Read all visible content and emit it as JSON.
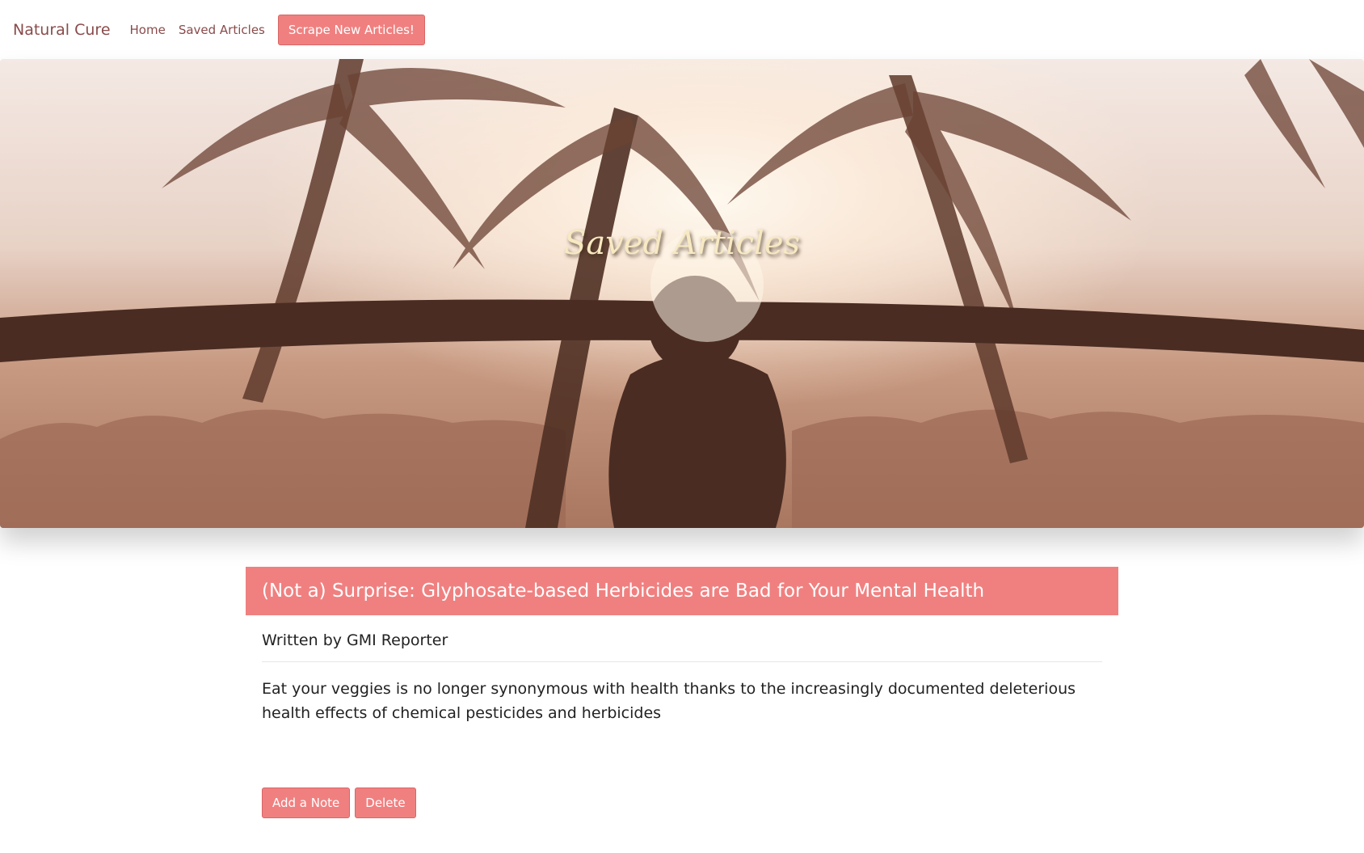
{
  "navbar": {
    "brand": "Natural Cure",
    "links": [
      {
        "label": "Home"
      },
      {
        "label": "Saved Articles"
      }
    ],
    "scrape_label": "Scrape New Articles!"
  },
  "hero": {
    "title": "Saved Articles"
  },
  "article": {
    "title": "(Not a) Surprise: Glyphosate-based Herbicides are Bad for Your Mental Health",
    "author": "Written by GMI Reporter",
    "summary": "Eat your veggies is no longer synonymous with health thanks to the increasingly documented deleterious health effects of chemical pesticides and herbicides",
    "add_note_label": "Add a Note",
    "delete_label": "Delete"
  },
  "colors": {
    "accent": "#f08080",
    "brand_text": "#8a4b4b"
  }
}
